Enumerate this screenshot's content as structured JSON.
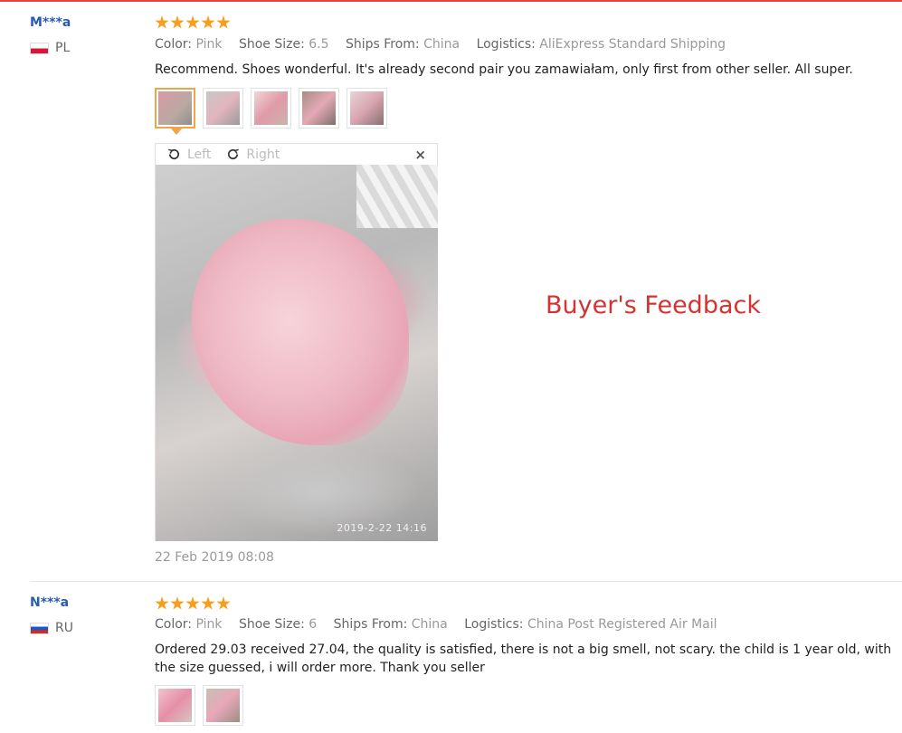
{
  "overlay_label": "Buyer's Feedback",
  "reviews": [
    {
      "user": "M***a",
      "country": "PL",
      "stars": 5,
      "attributes": {
        "color_label": "Color:",
        "color": "Pink",
        "size_label": "Shoe Size:",
        "size": "6.5",
        "ships_label": "Ships From:",
        "ships": "China",
        "logistics_label": "Logistics:",
        "logistics": "AliExpress Standard Shipping"
      },
      "text": "Recommend. Shoes wonderful. It's already second pair you zamawiałam, only first from other seller. All super.",
      "viewer": {
        "left_label": "Left",
        "right_label": "Right",
        "close": "×",
        "photo_timestamp": "2019-2-22 14:16"
      },
      "date": "22 Feb 2019 08:08"
    },
    {
      "user": "N***a",
      "country": "RU",
      "stars": 5,
      "attributes": {
        "color_label": "Color:",
        "color": "Pink",
        "size_label": "Shoe Size:",
        "size": "6",
        "ships_label": "Ships From:",
        "ships": "China",
        "logistics_label": "Logistics:",
        "logistics": "China Post Registered Air Mail"
      },
      "text": "Ordered 29.03 received 27.04, the quality is satisfied, there is not a big smell, not scary. the child is 1 year old, with the size guessed, i will order more. Thank you seller"
    }
  ],
  "colors": {
    "accent": "#e64545",
    "star": "#f79e1b",
    "username": "#2a5bb0",
    "selected_thumb": "#f0a347",
    "overlay_text": "#d63232"
  }
}
